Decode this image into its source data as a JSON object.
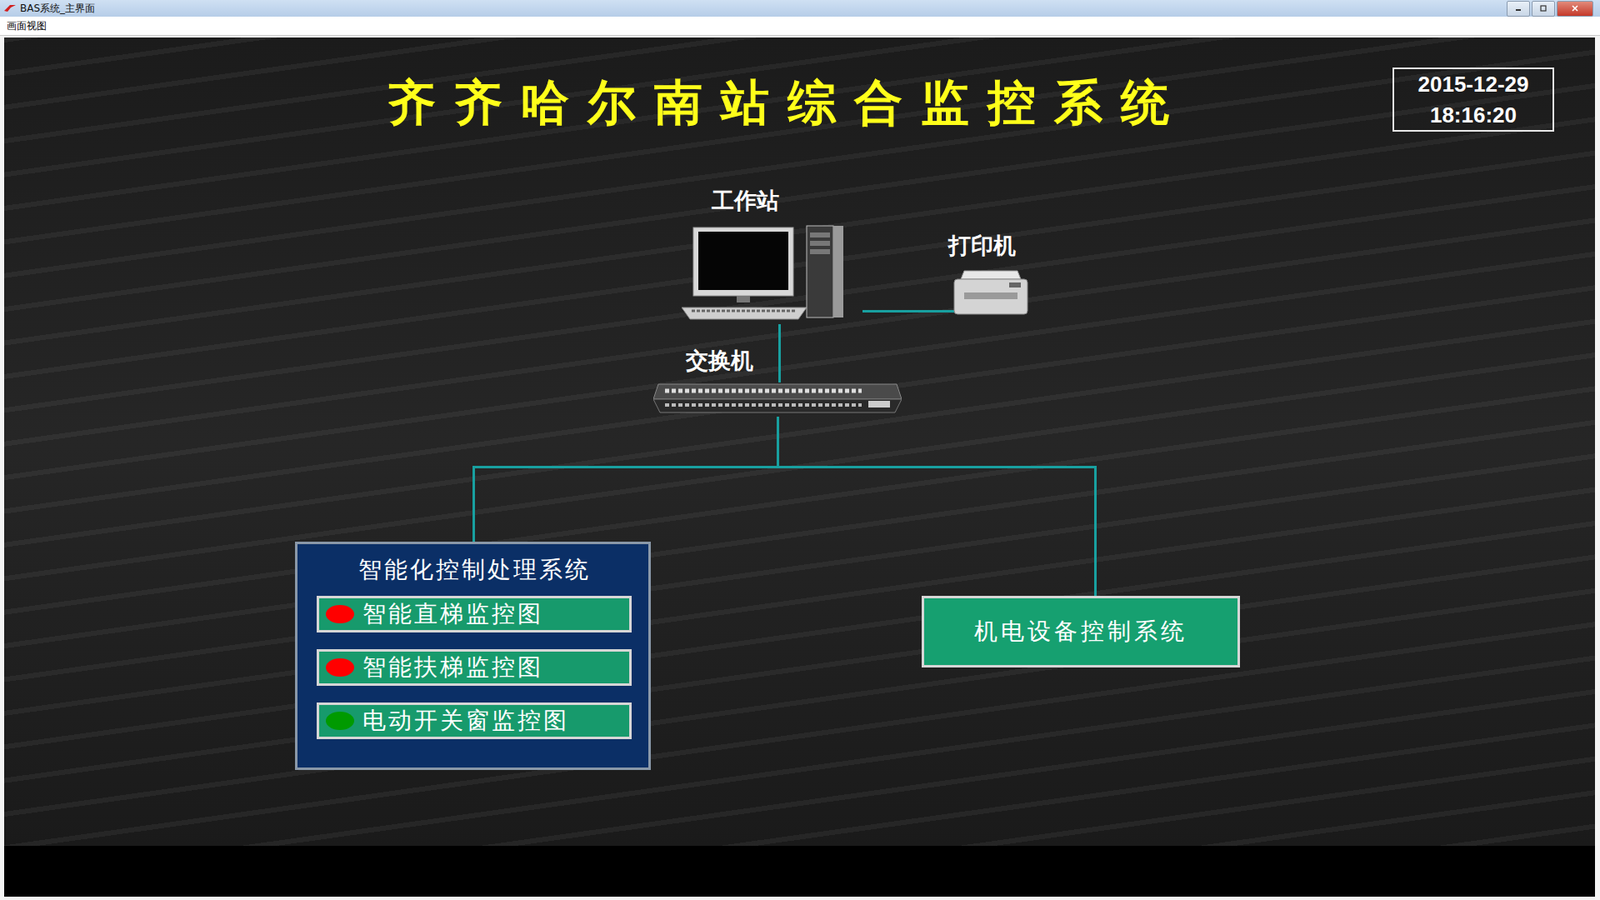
{
  "window": {
    "title": "BAS系统_主界面"
  },
  "menu": [
    "画面视图"
  ],
  "header": {
    "title": "齐齐哈尔南站综合监控系统",
    "date": "2015-12-29",
    "time": "18:16:20"
  },
  "diagram": {
    "workstation": "工作站",
    "printer": "打印机",
    "switch": "交换机"
  },
  "intelligent_panel": {
    "title": "智能化控制处理系统",
    "items": [
      {
        "label": "智能直梯监控图",
        "color": "#ff0000"
      },
      {
        "label": "智能扶梯监控图",
        "color": "#ff0000"
      },
      {
        "label": "电动开关窗监控图",
        "color": "#009a00"
      }
    ]
  },
  "mep_system": {
    "label": "机电设备控制系统"
  }
}
